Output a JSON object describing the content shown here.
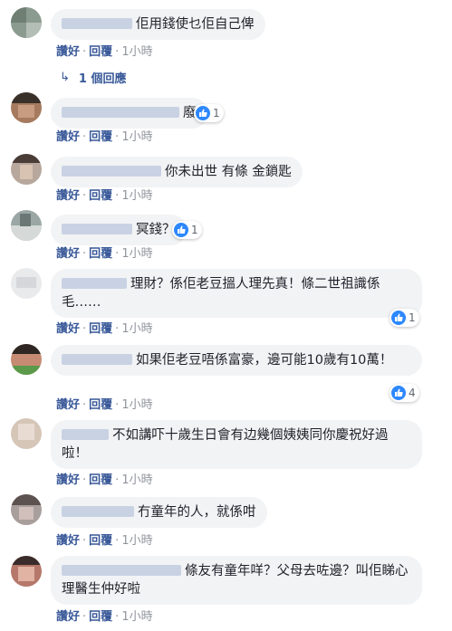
{
  "colors": {
    "link": "#385898",
    "bubble": "#f2f3f5",
    "like": "#2d88ff",
    "muted": "#90949c"
  },
  "actions": {
    "like": "讚好",
    "reply": "回覆",
    "separator": "·"
  },
  "reply_link": {
    "icon": "reply-arrow-icon",
    "label": "1 個回應"
  },
  "comments": [
    {
      "text": "佢用錢使乜佢自己俾",
      "time": "1小時",
      "reactions": null
    },
    {
      "text": "廢",
      "time": "1小時",
      "reactions": "1"
    },
    {
      "text": "你未出世 有條 金鎖匙",
      "time": "1小時",
      "reactions": null
    },
    {
      "text": "冥錢？",
      "time": "1小時",
      "reactions": "1"
    },
    {
      "text": "理財？係佢老豆搵人理先真！條二世祖識係毛……",
      "time": "1小時",
      "reactions": "1"
    },
    {
      "text": "如果佢老豆唔係富豪，邊可能10歲有10萬！",
      "time": "1小時",
      "reactions": "4"
    },
    {
      "text": "不如講吓十歲生日會有边幾個姨姨同你慶祝好過啦！",
      "time": "1小時",
      "reactions": null
    },
    {
      "text": "冇童年的人，就係咁",
      "time": "1小時",
      "reactions": null
    },
    {
      "text": "條友有童年咩？父母去咗邊？叫佢睇心理醫生仲好啦",
      "time": "1小時",
      "reactions": null
    }
  ]
}
